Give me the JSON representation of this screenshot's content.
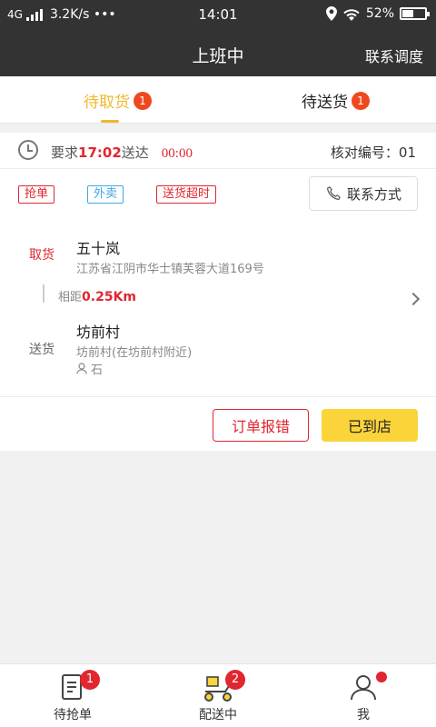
{
  "status_bar": {
    "network": "4G",
    "speed": "3.2K/s •••",
    "time": "14:01",
    "battery": "52%",
    "battery_level": 0.52
  },
  "header": {
    "title": "上班中",
    "contact_label": "联系调度"
  },
  "tabs": [
    {
      "label": "待取货",
      "badge": "1",
      "active": true
    },
    {
      "label": "待送货",
      "badge": "1",
      "active": false
    }
  ],
  "order": {
    "required_prefix": "要求",
    "required_time": "17:02",
    "required_suffix": "送达",
    "countdown": "00:00",
    "check_no": "核对编号：01",
    "tags": [
      "抢单",
      "外卖",
      "送货超时"
    ],
    "contact_button": "联系方式",
    "pickup": {
      "label": "取货",
      "name": "五十岚",
      "address": "江苏省江阴市华士镇芙蓉大道169号"
    },
    "distance_label": "相距",
    "distance_value": "0.25Km",
    "delivery": {
      "label": "送货",
      "name": "坊前村",
      "address": "坊前村(在坊前村附近)",
      "recipient": "石"
    },
    "report_button": "订单报错",
    "arrived_button": "已到店"
  },
  "bottom_nav": [
    {
      "label": "待抢单",
      "badge": "1",
      "icon": "order-list-icon"
    },
    {
      "label": "配送中",
      "badge": "2",
      "icon": "delivery-scooter-icon"
    },
    {
      "label": "我",
      "icon": "user-icon"
    }
  ],
  "colors": {
    "accent": "#f1b82c",
    "alert": "#e0262f",
    "badge": "#f0481e",
    "primary_button": "#fbd43a",
    "header_bg": "#333333"
  }
}
